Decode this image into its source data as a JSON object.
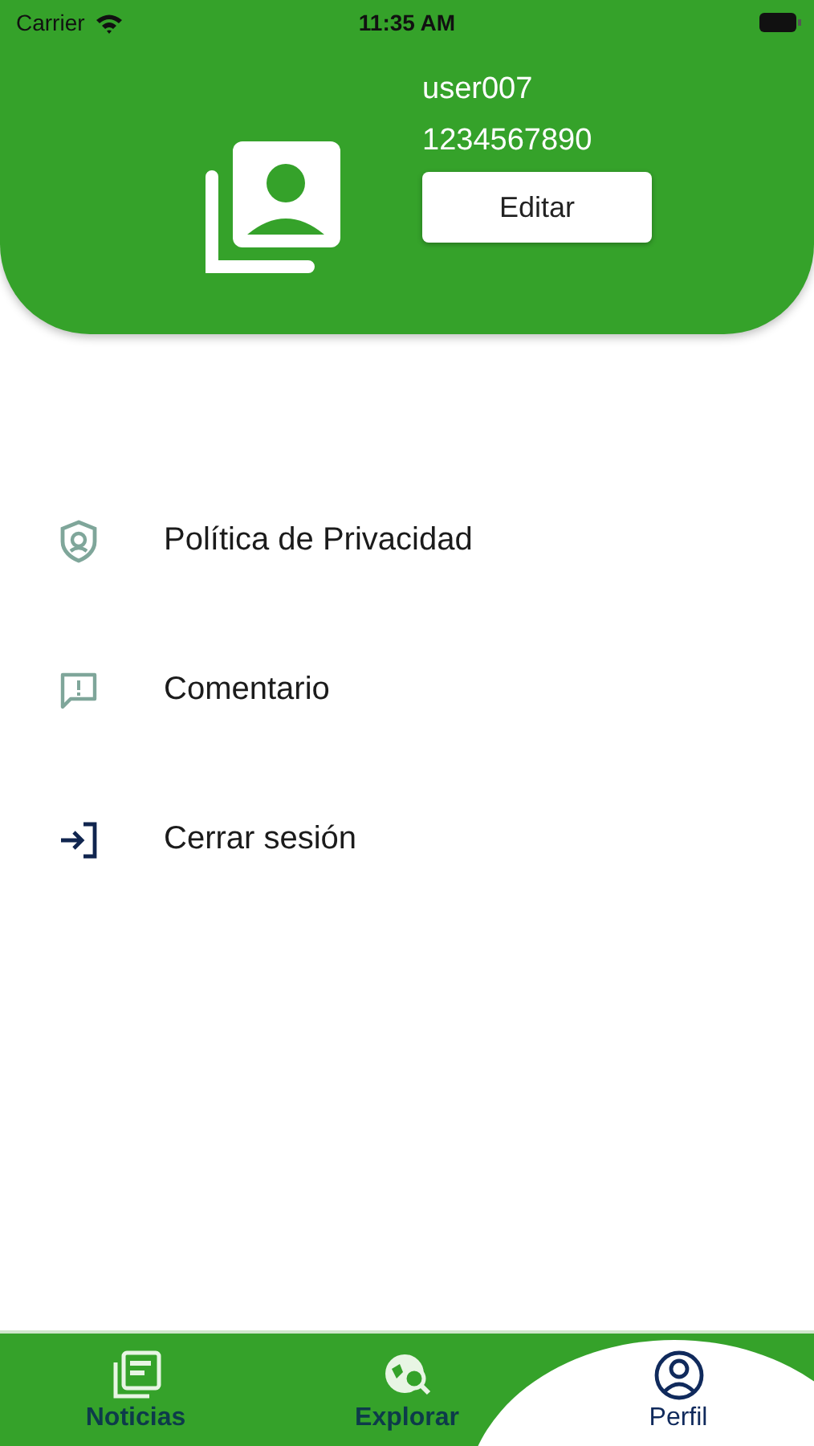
{
  "status_bar": {
    "carrier": "Carrier",
    "time": "11:35 AM"
  },
  "profile": {
    "username": "user007",
    "phone": "1234567890",
    "edit_button": "Editar"
  },
  "menu": [
    {
      "label": "Política de Privacidad",
      "kind": "privacy"
    },
    {
      "label": "Comentario",
      "kind": "feedback"
    },
    {
      "label": "Cerrar sesión",
      "kind": "logout"
    }
  ],
  "tabs": [
    {
      "label": "Noticias",
      "kind": "news",
      "selected": false
    },
    {
      "label": "Explorar",
      "kind": "explore",
      "selected": false
    },
    {
      "label": "Perfil",
      "kind": "profile",
      "selected": true
    }
  ]
}
